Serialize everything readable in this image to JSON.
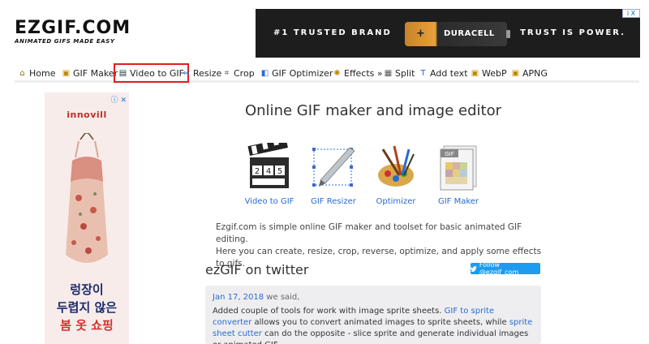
{
  "header": {
    "logo_main": "EZGIF.COM",
    "logo_sub": "ANIMATED GIFS MADE EASY"
  },
  "top_ad": {
    "left_text": "#1 TRUSTED BRAND",
    "battery_brand": "DURACELL",
    "battery_sign": "+",
    "right_text": "TRUST IS POWER.",
    "adchoice": "i X"
  },
  "nav": {
    "items": [
      {
        "label": "Home",
        "icon": "home-icon"
      },
      {
        "label": "GIF Maker",
        "icon": "gif-icon"
      },
      {
        "label": "Video to GIF",
        "icon": "film-icon"
      },
      {
        "label": "Resize",
        "icon": "resize-icon"
      },
      {
        "label": "Crop",
        "icon": "crop-icon"
      },
      {
        "label": "GIF Optimizer",
        "icon": "optimizer-icon"
      },
      {
        "label": "Effects »",
        "icon": "effects-icon"
      },
      {
        "label": "Split",
        "icon": "split-icon"
      },
      {
        "label": "Add text",
        "icon": "text-icon"
      },
      {
        "label": "WebP",
        "icon": "webp-icon"
      },
      {
        "label": "APNG",
        "icon": "apng-icon"
      }
    ],
    "highlighted_index": 2,
    "highlight_color": "#e02020"
  },
  "side_ad": {
    "brand": "innovill",
    "close": "ⓘ ✕",
    "line1": "렁장이",
    "line2": "두렵지 않은",
    "line3": "봄 옷 쇼핑"
  },
  "main": {
    "title": "Online GIF maker and image editor",
    "tools": [
      {
        "label": "Video to GIF",
        "icon": "clapperboard-icon"
      },
      {
        "label": "GIF Resizer",
        "icon": "resizer-icon"
      },
      {
        "label": "Optimizer",
        "icon": "paintbrushes-icon"
      },
      {
        "label": "GIF Maker",
        "icon": "gif-document-icon"
      }
    ],
    "clapper_digits": [
      "2",
      "4",
      "5"
    ],
    "gif_doc_tag": "GIF",
    "intro_line1": "Ezgif.com is simple online GIF maker and toolset for basic animated GIF editing.",
    "intro_line2": "Here you can create, resize, crop, reverse, optimize, and apply some effects to gifs."
  },
  "twitter": {
    "heading": "ezGIF on twitter",
    "follow_label": "Follow @ezgif_com",
    "tweet_date": "Jan 17, 2018",
    "tweet_said": " we said,",
    "tweet_part1": "Added couple of tools for work with image sprite sheets. ",
    "tweet_link1": "GIF to sprite converter",
    "tweet_part2": " allows you to convert animated images to sprite sheets, while ",
    "tweet_link2": "sprite sheet cutter",
    "tweet_part3": " can do the opposite - slice sprite and generate individual images or animated GIF."
  },
  "colors": {
    "link": "#2a6bd1",
    "twitter_blue": "#1d9bf0",
    "tweet_bg": "#eeeef0"
  }
}
